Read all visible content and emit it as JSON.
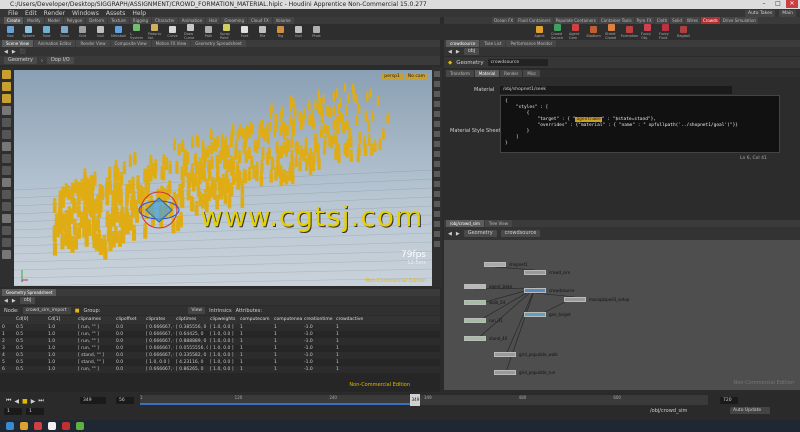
{
  "window": {
    "title": "C:/Users/Developer/Desktop/SIGGRAPH/ASSIGNMENT/CROWD_FORMATION_MATERIAL.hiplc - Houdini Apprentice Non-Commercial 15.0.277"
  },
  "menu": {
    "items": [
      "File",
      "Edit",
      "Render",
      "Windows",
      "Assets",
      "Help"
    ],
    "auto_takes": "Auto Takes",
    "desktop": "Main"
  },
  "shelf": {
    "tabs_left": [
      "Create",
      "Modify",
      "Model",
      "Polygon",
      "Deform",
      "Texture",
      "Rigging",
      "Character",
      "Animation",
      "Hair",
      "Grooming",
      "Cloud FX",
      "Volume"
    ],
    "active_left": "Create",
    "tabs_right": [
      "Ocean FX",
      "Fluid Containers",
      "Populate Containers",
      "Container Tools",
      "Pyro FX",
      "Cloth",
      "Solid",
      "Wires",
      "Crowds",
      "Drive Simulation"
    ],
    "active_right": "Crowds",
    "tools": [
      "Box",
      "Sphere",
      "Tube",
      "Torus",
      "Grid",
      "Null",
      "Metaball",
      "L-System",
      "Platonic Sol.",
      "Curve",
      "Draw Curve",
      "Path",
      "Spray Paint",
      "Font",
      "File",
      "Rig",
      "Null",
      "Pivot"
    ],
    "tools_right": [
      "Agent",
      "Crowd Source",
      "Agent Cam",
      "Stadium",
      "Street Crowd",
      "Formation",
      "Fuzzy Obj.",
      "Fuzzy Fluid",
      "Ragdoll"
    ]
  },
  "scene_view": {
    "tabs": [
      "Scene View",
      "Animation Editor",
      "Render View",
      "Composite View",
      "Motion FX View",
      "Geometry Spreadsheet"
    ],
    "path_context": "Geometry",
    "path_node": "Dop I/O",
    "camera": "persp1",
    "display": "No cam",
    "fps": "79fps",
    "fps_sub": "12.5ms",
    "watermark": "Non-Commercial Edition"
  },
  "spreadsheet": {
    "tab": "Geometry Spreadsheet",
    "path": "obj",
    "node_label": "Node:",
    "node": "crowd_sim_import",
    "group_label": "Group:",
    "view_label": "View",
    "intrinsics_label": "Intrinsics",
    "attributes_label": "Attributes:",
    "columns": [
      "",
      "Cd[0]",
      "Cd[1]",
      "clipnames",
      "clipoffset",
      "cliprates",
      "cliptimes",
      "clipweights",
      "computecam",
      "computeneass",
      "creationtime",
      "crowdactive",
      "",
      ""
    ],
    "rows": [
      [
        "0",
        "0.5",
        "1.0",
        "[ run, \"\" ]",
        "0.0",
        "[ 0.666667, 0",
        "[ 0.385556, 0",
        "[ 1.0, 0.0 ]",
        "1",
        "1",
        "-1.0",
        "1",
        "",
        ""
      ],
      [
        "1",
        "0.5",
        "1.0",
        "[ run, \"\" ]",
        "0.0",
        "[ 0.666667, 0",
        "[ 0.64425, 0",
        "[ 1.0, 0.0 ]",
        "1",
        "1",
        "-1.0",
        "1",
        "",
        ""
      ],
      [
        "2",
        "0.5",
        "1.0",
        "[ run, \"\" ]",
        "0.0",
        "[ 0.666667, 0",
        "[ 0.888889, 0",
        "[ 1.0, 0.0 ]",
        "1",
        "1",
        "-1.0",
        "1",
        "",
        ""
      ],
      [
        "3",
        "0.5",
        "1.0",
        "[ run, \"\" ]",
        "0.0",
        "[ 0.666667, 0",
        "[ 0.0555556, 0",
        "[ 1.0, 0.0 ]",
        "1",
        "1",
        "-1.0",
        "1",
        "",
        ""
      ],
      [
        "4",
        "0.5",
        "1.0",
        "[ stand, \"\" ]",
        "0.0",
        "[ 0.666667, 0",
        "[ 0.335582, 0",
        "[ 1.0, 0.0 ]",
        "1",
        "1",
        "-1.0",
        "1",
        "",
        ""
      ],
      [
        "5",
        "0.5",
        "1.0",
        "[ stand, \"\" ]",
        "0.0",
        "[ 1.0, 0.0 ]",
        "[ 4.23116, 0",
        "[ 1.0, 0.0 ]",
        "1",
        "1",
        "-1.0",
        "1",
        "",
        ""
      ],
      [
        "6",
        "0.5",
        "1.0",
        "[ run, \"\" ]",
        "0.0",
        "[ 0.666667, 0",
        "[ 0.86265, 0",
        "[ 1.0, 0.0 ]",
        "1",
        "1",
        "-1.0",
        "1",
        "",
        ""
      ]
    ],
    "watermark": "Non-Commercial Edition"
  },
  "params": {
    "tabs": [
      "crowdsource",
      "Take List",
      "Performance Monitor"
    ],
    "path": "obj",
    "node_type": "Geometry",
    "node_name": "crowdsource",
    "subtabs": [
      "Transform",
      "Material",
      "Render",
      "Misc"
    ],
    "material_label": "Material",
    "material_value": "/obj/shopnet1/seek",
    "style_sheet_label": "Material Style Sheet",
    "code_lines": [
      "{",
      "    \"styles\" : [",
      "        {",
      "            \"target\" : { \"agentname\" : \"$state=stand\"},",
      "            \"overrides\" : {\"material\" : { \"name\" : \" opfullpath('../shopnet1/goal')\"}}",
      "        }",
      "    ]",
      "}"
    ],
    "code_highlight": "agentname",
    "cursor_pos": "Ln 6, Col 41"
  },
  "network": {
    "tabs": [
      "/obj/crowd_sim",
      "Tree View"
    ],
    "path_context": "Geometry",
    "path_node": "crowdsource",
    "nodes": [
      {
        "name": "shopnet1"
      },
      {
        "name": "crowd_sim"
      },
      {
        "name": "agent_bake"
      },
      {
        "name": "crowdsource"
      },
      {
        "name": "mocapbiped3_setup"
      },
      {
        "name": "walk_24"
      },
      {
        "name": "gen_target"
      },
      {
        "name": "run_31"
      },
      {
        "name": "stand_40"
      },
      {
        "name": "grid_populate_walk"
      },
      {
        "name": "grid_populate_run"
      }
    ],
    "watermark": "Non-Commercial Edition"
  },
  "timeline": {
    "current_frame": "349",
    "start": "1",
    "start_field": "1",
    "end_field": "720",
    "end": "720",
    "step": "56",
    "ticks": [
      "1",
      "120",
      "240",
      "349",
      "480",
      "600"
    ],
    "progress": 0.485,
    "obj_path": "/obj/crowd_sim",
    "auto_update": "Auto Update"
  },
  "watermark_text": "www.cgtsj.com",
  "colors": {
    "accent": "#e6b800",
    "crowd": "#e0ac14",
    "selected_tab": "#b03030"
  }
}
